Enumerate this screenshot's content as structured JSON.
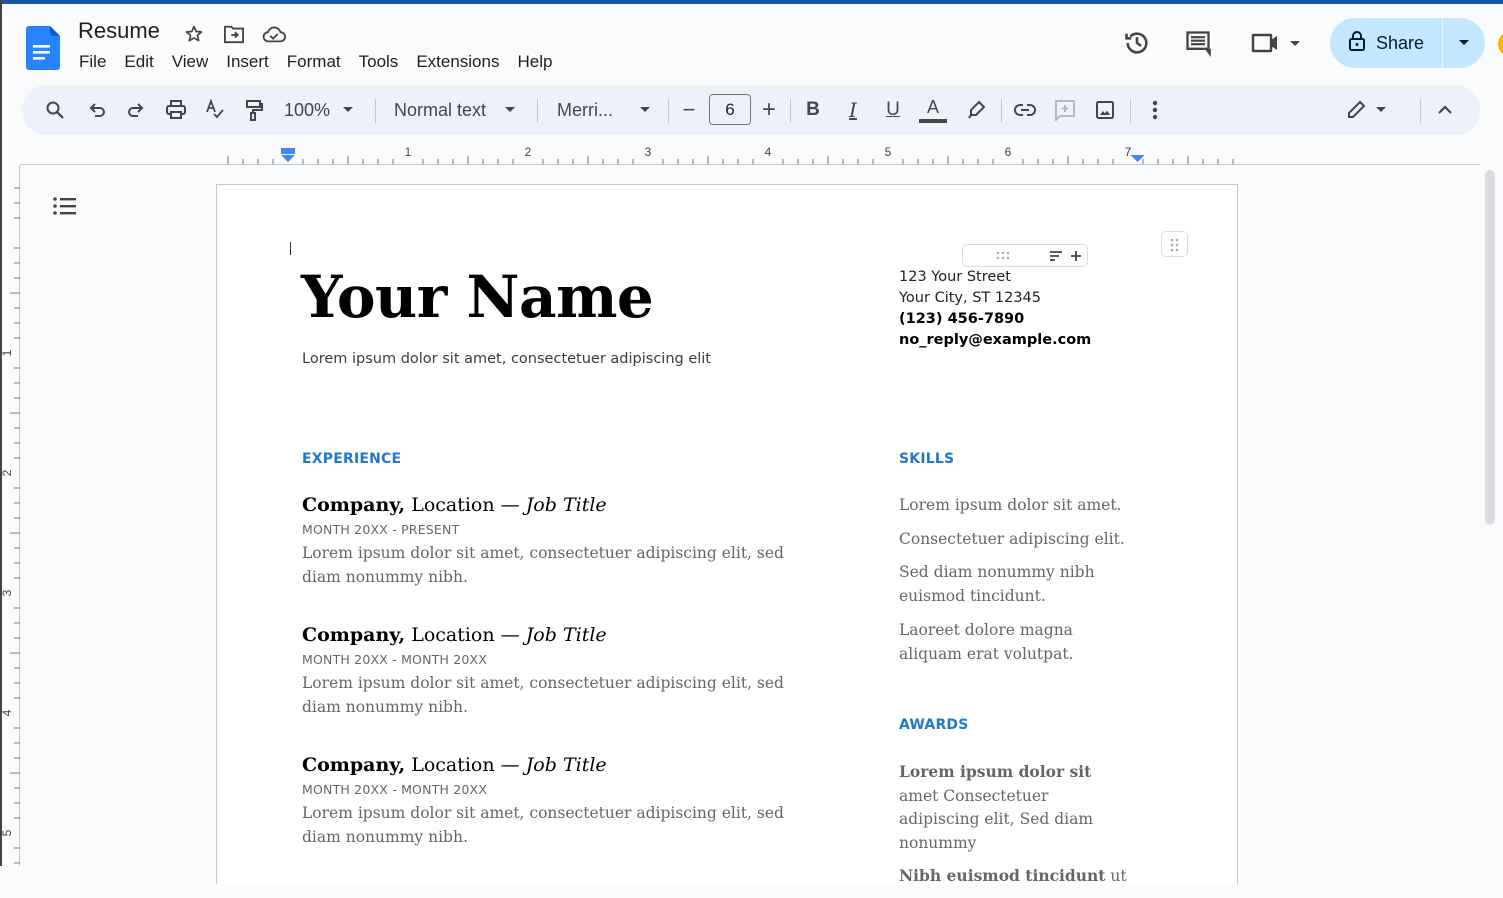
{
  "app": {
    "title": "Resume",
    "menu": [
      "File",
      "Edit",
      "View",
      "Insert",
      "Format",
      "Tools",
      "Extensions",
      "Help"
    ],
    "share_label": "Share",
    "icons": {
      "doc_logo": "google-docs-icon",
      "star": "star-icon",
      "move": "move-to-folder-icon",
      "cloud": "cloud-saved-icon",
      "history": "version-history-icon",
      "comments": "comments-icon",
      "meet": "video-call-icon",
      "lock": "lock-icon"
    },
    "colors": {
      "accent": "#2079c7",
      "share_bg": "#c2e7ff",
      "toolbar_bg": "#edf2fa",
      "top_border": "#1a56a0"
    }
  },
  "toolbar": {
    "zoom": "100%",
    "style": "Normal text",
    "font": "Merri...",
    "font_size": "6",
    "decrease_label": "−",
    "increase_label": "+",
    "bold_label": "B",
    "italic_label": "I",
    "underline_label": "U",
    "text_color_label": "A"
  },
  "ruler": {
    "labels": [
      "1",
      "2",
      "3",
      "4",
      "5",
      "6",
      "7"
    ],
    "vertical_labels": [
      "1",
      "2",
      "3",
      "4",
      "5"
    ]
  },
  "document": {
    "name": "Your Name",
    "subtitle": "Lorem ipsum dolor sit amet, consectetuer adipiscing elit",
    "contact": {
      "street": "123 Your Street",
      "city": "Your City, ST 12345",
      "phone": "(123) 456-7890",
      "email": "no_reply@example.com"
    },
    "experience": {
      "heading": "EXPERIENCE",
      "jobs": [
        {
          "company": "Company,",
          "location": " Location — ",
          "title": "Job Title",
          "dates": "MONTH 20XX - PRESENT",
          "description": "Lorem ipsum dolor sit amet, consectetuer adipiscing elit, sed diam nonummy nibh."
        },
        {
          "company": "Company,",
          "location": " Location — ",
          "title": "Job Title",
          "dates": "MONTH 20XX - MONTH 20XX",
          "description": "Lorem ipsum dolor sit amet, consectetuer adipiscing elit, sed diam nonummy nibh."
        },
        {
          "company": "Company,",
          "location": " Location — ",
          "title": "Job Title",
          "dates": "MONTH 20XX - MONTH 20XX",
          "description": "Lorem ipsum dolor sit amet, consectetuer adipiscing elit, sed diam nonummy nibh."
        }
      ]
    },
    "skills": {
      "heading": "SKILLS",
      "items": [
        "Lorem ipsum dolor sit amet.",
        "Consectetuer adipiscing elit.",
        "Sed diam nonummy nibh euismod tincidunt.",
        "Laoreet dolore magna aliquam erat volutpat."
      ]
    },
    "awards": {
      "heading": "AWARDS",
      "items": [
        {
          "bold": "Lorem ipsum dolor sit",
          "rest": " amet Consectetuer adipiscing elit, Sed diam nonummy"
        },
        {
          "bold": "Nibh euismod tincidunt",
          "rest": " ut"
        }
      ]
    }
  }
}
